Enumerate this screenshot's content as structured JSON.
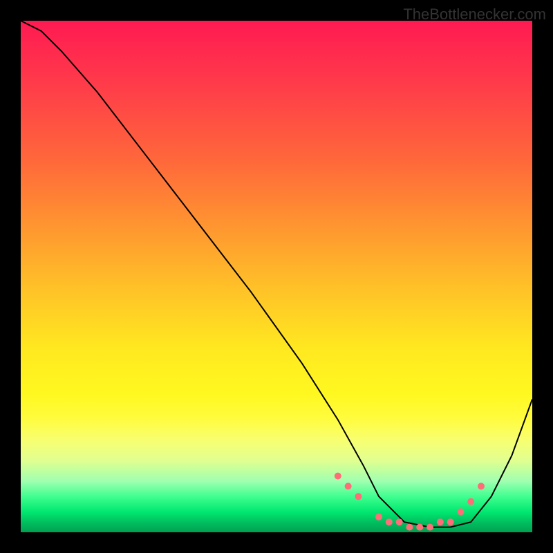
{
  "watermark": "TheBottlenecker.com",
  "chart_data": {
    "type": "line",
    "title": "",
    "xlabel": "",
    "ylabel": "",
    "xlim": [
      0,
      100
    ],
    "ylim": [
      0,
      100
    ],
    "series": [
      {
        "name": "curve",
        "x": [
          0,
          4,
          8,
          15,
          25,
          35,
          45,
          55,
          62,
          67,
          70,
          75,
          80,
          84,
          88,
          92,
          96,
          100
        ],
        "values": [
          100,
          98,
          94,
          86,
          73,
          60,
          47,
          33,
          22,
          13,
          7,
          2,
          1,
          1,
          2,
          7,
          15,
          26
        ]
      }
    ],
    "markers": {
      "name": "highlight-dots",
      "color": "#ff6e78",
      "x": [
        62,
        64,
        66,
        70,
        72,
        74,
        76,
        78,
        80,
        82,
        84,
        86,
        88,
        90
      ],
      "values": [
        11,
        9,
        7,
        3,
        2,
        2,
        1,
        1,
        1,
        2,
        2,
        4,
        6,
        9
      ]
    },
    "background_gradient": {
      "top": "#ff1a52",
      "mid": "#ffe820",
      "bottom": "#00c060"
    }
  }
}
